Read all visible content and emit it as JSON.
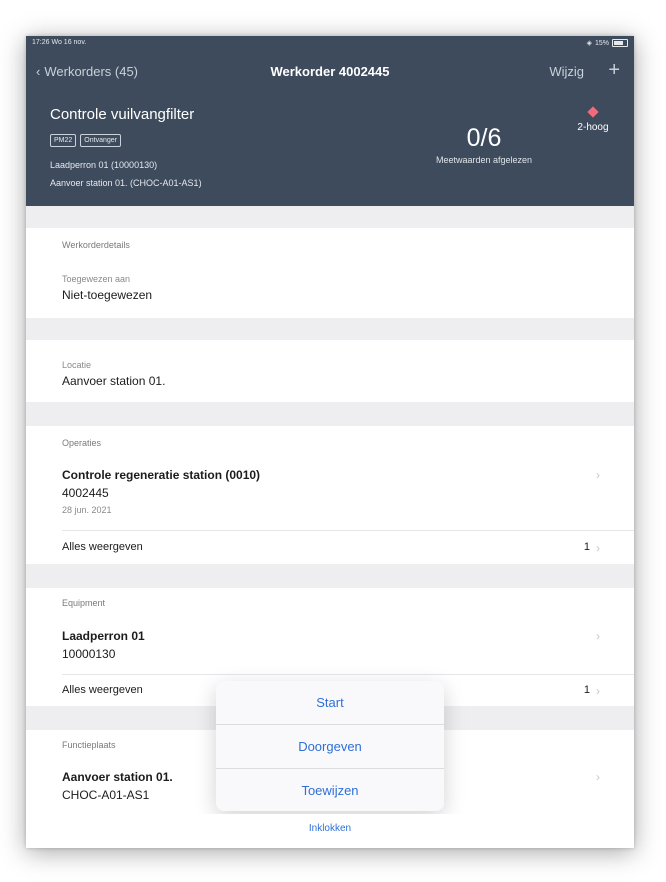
{
  "statusbar": {
    "time": "17:26",
    "date": "Wo 16 nov.",
    "battery": "15%"
  },
  "navbar": {
    "back_label": "Werkorders (45)",
    "title": "Werkorder 4002445",
    "edit_label": "Wijzig",
    "add_label": "+"
  },
  "workorder": {
    "title": "Controle vuilvangfilter",
    "tags": [
      "PM22",
      "Ontvanger"
    ],
    "location_line1": "Laadperron 01 (10000130)",
    "location_line2": "Aanvoer station 01. (CHOC-A01-AS1)",
    "counter_value": "0/6",
    "counter_label": "Meetwaarden afgelezen",
    "priority": "2-hoog"
  },
  "details": {
    "section_label": "Werkorderdetails",
    "assigned_label": "Toegewezen aan",
    "assigned_value": "Niet-toegewezen"
  },
  "location": {
    "label": "Locatie",
    "value": "Aanvoer station 01."
  },
  "operations": {
    "section_label": "Operaties",
    "item_title": "Controle regeneratie station (0010)",
    "item_number": "4002445",
    "item_date": "28 jun. 2021",
    "show_all_label": "Alles weergeven",
    "count": "1"
  },
  "equipment": {
    "section_label": "Equipment",
    "item_title": "Laadperron 01",
    "item_number": "10000130",
    "show_all_label": "Alles weergeven",
    "count": "1"
  },
  "functional_location": {
    "section_label": "Functieplaats",
    "item_title": "Aanvoer station 01.",
    "item_code": "CHOC-A01-AS1"
  },
  "actions": {
    "start": "Start",
    "forward": "Doorgeven",
    "assign": "Toewijzen",
    "collapse": "Inklokken"
  },
  "colors": {
    "header_bg": "#3d4b5c",
    "accent": "#2f6fd6",
    "priority": "#f36b7a"
  }
}
